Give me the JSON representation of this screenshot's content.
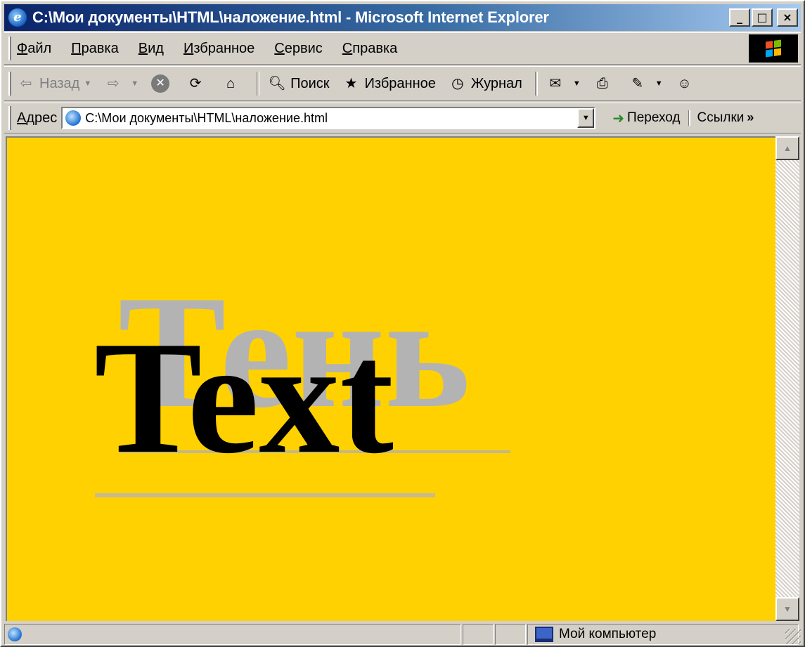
{
  "window": {
    "title": "C:\\Мои документы\\HTML\\наложение.html - Microsoft Internet Explorer",
    "controls": {
      "minimize": "_",
      "maximize": "□",
      "close": "×"
    }
  },
  "menu": {
    "items": [
      "Файл",
      "Правка",
      "Вид",
      "Избранное",
      "Сервис",
      "Справка"
    ]
  },
  "toolbar": {
    "back_label": "Назад",
    "search_label": "Поиск",
    "favorites_label": "Избранное",
    "history_label": "Журнал"
  },
  "address": {
    "label": "Адрес",
    "url": "C:\\Мои документы\\HTML\\наложение.html",
    "go_label": "Переход",
    "links_label": "Ссылки"
  },
  "page": {
    "background_color": "#ffd100",
    "shadow_text": "Тень",
    "shadow_color": "#b3b3b3",
    "main_text": "Text",
    "main_color": "#000000"
  },
  "status": {
    "zone_label": "Мой компьютер"
  }
}
